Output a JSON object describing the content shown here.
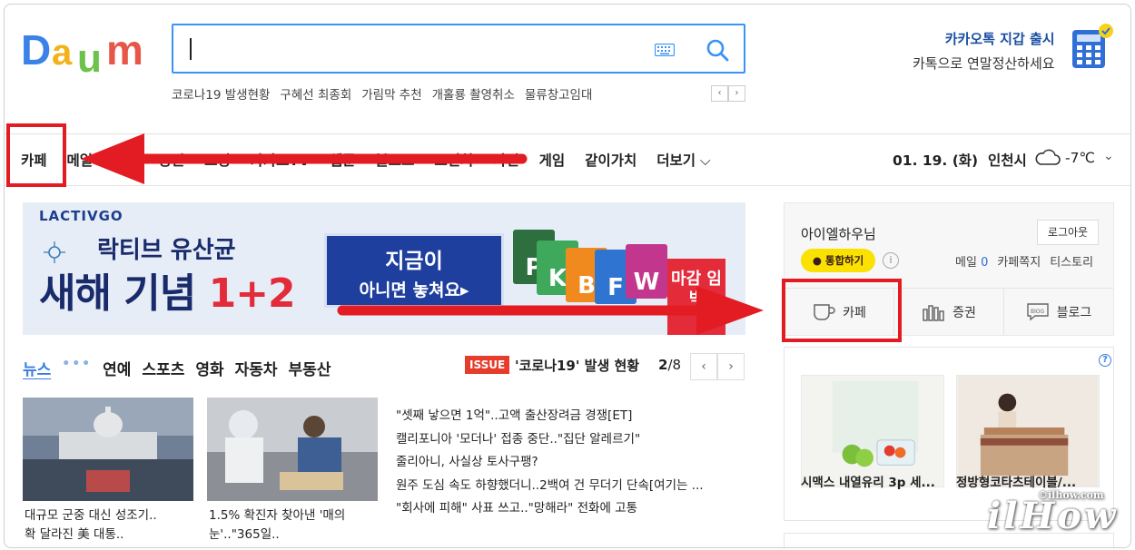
{
  "header": {
    "logo_text": "Daum",
    "trending": [
      "코로나19 발생현황",
      "구혜선 최종회",
      "가림막 추천",
      "개홀룡 촬영취소",
      "물류창고임대"
    ],
    "trend_prev": "‹",
    "trend_next": "›",
    "promo_line1": "카카오톡 지갑 출시",
    "promo_line2": "카톡으로 연말정산하세요"
  },
  "nav": {
    "items": [
      "카페",
      "메일",
      "지도",
      "증권",
      "쇼핑",
      "카카오TV",
      "웹툰",
      "블로그",
      "브런치",
      "사전",
      "게임",
      "같이가치"
    ],
    "more": "더보기",
    "date": "01. 19. (화)",
    "city": "인천시",
    "temp": "-7℃",
    "temp_chevron": "⌄"
  },
  "banner": {
    "brand": "LACTIVGO",
    "line1": "락티브 유산균",
    "line2_prefix": "새해 기념",
    "line2_accent": "1+2",
    "cta_line1": "지금이",
    "cta_line2": "아니면 놓쳐요▸",
    "box_letters": [
      "P",
      "K",
      "B",
      "F",
      "W"
    ],
    "side_text": "마감 임박"
  },
  "news": {
    "tabs": [
      "뉴스",
      "연예",
      "스포츠",
      "영화",
      "자동차",
      "부동산"
    ],
    "tab_dots": "•••",
    "issue_badge": "ISSUE",
    "issue_title": "'코로나19' 발생 현황",
    "pager_current": "2",
    "pager_total": "/8",
    "pager_prev": "‹",
    "pager_next": "›",
    "thumb_captions": [
      [
        "대규모 군중 대신 성조기..",
        "확 달라진 美 대통.."
      ],
      [
        "1.5% 확진자 찾아낸 '매의",
        "눈'..\"365일.."
      ]
    ],
    "headlines": [
      "\"셋째 낳으면 1억\"..고액 출산장려금 경쟁[ET]",
      "캘리포니아 '모더나' 접종 중단..\"집단 알레르기\"",
      "줄리아니, 사실상 토사구팽?",
      "원주 도심 속도 하향했더니..2백여 건 무더기 단속[여기는 ...",
      "\"회사에 피해\" 사표 쓰고..\"망해라\" 전화에 고통"
    ]
  },
  "user_panel": {
    "user_name": "아이엘하우님",
    "logout": "로그아웃",
    "kakao_button": "통합하기",
    "info": "i",
    "mail_label": "메일",
    "mail_count": "0",
    "cafe_note": "카페쪽지",
    "story": "티스토리",
    "services": [
      "카페",
      "증권",
      "블로그"
    ]
  },
  "shopping": {
    "help": "?",
    "products": [
      "시맥스 내열유리 3p 세...",
      "정방형코타츠테이블/..."
    ]
  },
  "watermark": {
    "text": "ilHow",
    "sub": "©ilhow.com"
  },
  "colors": {
    "annotation_red": "#e31b23",
    "search_blue": "#3a93f5",
    "kakao_yellow": "#fae100"
  }
}
